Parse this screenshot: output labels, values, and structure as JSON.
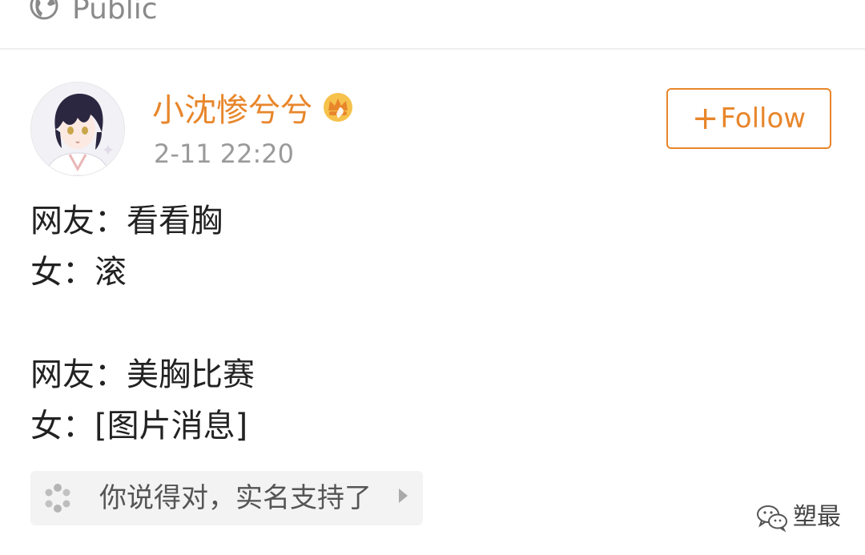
{
  "header": {
    "visibility_label": "Public",
    "visibility_icon": "globe-icon"
  },
  "post": {
    "author": {
      "name": "小沈惨兮兮",
      "badge_icon": "crown-icon",
      "name_color": "#e8862b",
      "avatar_icon": "avatar-image"
    },
    "timestamp": "2-11 22:20",
    "follow_button": {
      "plus": "+",
      "label": "Follow",
      "accent": "#e8862b"
    },
    "lines": [
      "网友：看看胸",
      "女：滚",
      "",
      "网友：美胸比赛",
      "女：[图片消息]"
    ],
    "topic": {
      "label": "你说得对，实名支持了",
      "icon": "loading-spinner-icon",
      "arrow_icon": "chevron-right-icon"
    }
  },
  "watermark": {
    "icon": "wechat-icon",
    "text": "塑最"
  }
}
